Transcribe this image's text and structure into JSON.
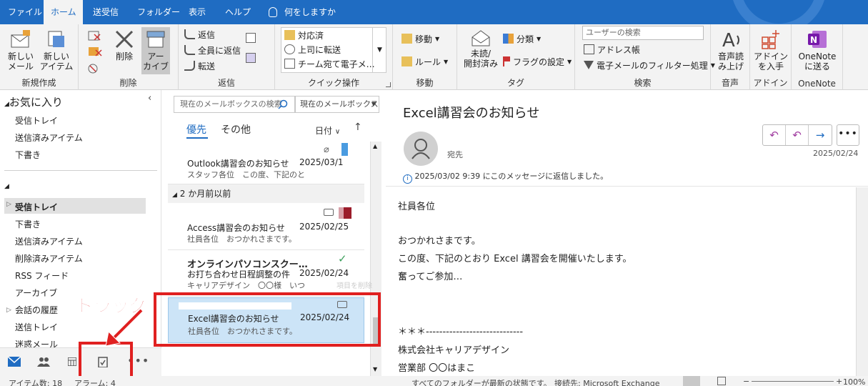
{
  "tabs": [
    "ファイル",
    "ホーム",
    "送受信",
    "フォルダー",
    "表示",
    "ヘルプ"
  ],
  "tellme": "何をしますか",
  "ribbon": {
    "new": {
      "new_mail": "新しい\nメール",
      "new_items": "新しい\nアイテム",
      "label": "新規作成"
    },
    "delete": {
      "delete": "削除",
      "archive": "アー\nカイブ",
      "label": "削除"
    },
    "respond": {
      "reply": "返信",
      "reply_all": "全員に返信",
      "forward": "転送",
      "label": "返信"
    },
    "quicksteps": {
      "items": [
        "対応済",
        "上司に転送",
        "チーム宛て電子メ…"
      ],
      "label": "クイック操作"
    },
    "move": {
      "move": "移動",
      "rules": "ルール",
      "label": "移動"
    },
    "tags": {
      "unread": "未読/\n開封済み",
      "categorize": "分類",
      "flag": "フラグの設定",
      "label": "タグ"
    },
    "find": {
      "search_people": "ユーザーの検索",
      "address_book": "アドレス帳",
      "filter": "電子メールのフィルター処理",
      "label": "検索"
    },
    "speech": {
      "read_aloud": "音声読\nみ上げ",
      "label": "音声"
    },
    "addins": {
      "get": "アドイン\nを入手",
      "label": "アドイン"
    },
    "onenote": {
      "send": "OneNote\nに送る",
      "label": "OneNote"
    }
  },
  "folders": {
    "favorites_label": "お気に入り",
    "favorites": [
      "受信トレイ",
      "送信済みアイテム",
      "下書き"
    ],
    "account_items": [
      "受信トレイ",
      "下書き",
      "送信済みアイテム",
      "削除済みアイテム",
      "RSS フィード",
      "アーカイブ",
      "会話の履歴",
      "送信トレイ",
      "迷惑メール"
    ]
  },
  "search": {
    "placeholder": "現在のメールボックスの検索",
    "scope": "現在のメールボックス"
  },
  "list": {
    "focused": "優先",
    "other": "その他",
    "sort": "日付",
    "group": "2 か月前以前",
    "messages": [
      {
        "from": "Outlook講習会のお知らせ",
        "subject": "",
        "preview": "スタッフ各位　この度、下記のと",
        "date": "2025/03/1"
      },
      {
        "from": "Access講習会のお知らせ",
        "subject": "",
        "preview": "社員各位　おつかれさまです。",
        "date": "2025/02/25"
      },
      {
        "from": "オンラインパソコンスクー…",
        "subject": "お打ち合わせ日程調整の件",
        "preview": "キャリアデザイン　〇〇様　いつ",
        "date": "2025/02/24",
        "hover": "項目を削除"
      },
      {
        "from": "Excel講習会のお知らせ",
        "subject": "",
        "preview": "社員各位　おつかれさまです。",
        "date": "2025/02/24"
      }
    ]
  },
  "reading": {
    "subject": "Excel講習会のお知らせ",
    "to_label": "宛先",
    "date": "2025/02/24",
    "info": "2025/03/02 9:39 にこのメッセージに返信しました。",
    "body": [
      "社員各位",
      "",
      "おつかれさまです。",
      "この度、下記のとおり Excel 講習会を開催いたします。",
      "奮ってご参加…",
      "",
      "",
      "",
      "＊＊＊-----------------------------",
      "株式会社キャリアデザイン",
      "営業部 〇〇はまこ"
    ]
  },
  "annotation": {
    "label": "ドラッグ",
    "color": "#e02020"
  },
  "status": {
    "items": "アイテム数: 18",
    "reminders": "アラーム: 4",
    "sync": "すべてのフォルダーが最新の状態です。",
    "connection": "接続先: Microsoft Exchange",
    "zoom": "100%"
  },
  "colors": {
    "accent": "#1f6cc2",
    "selected": "#cce4f7",
    "red": "#e02020"
  }
}
